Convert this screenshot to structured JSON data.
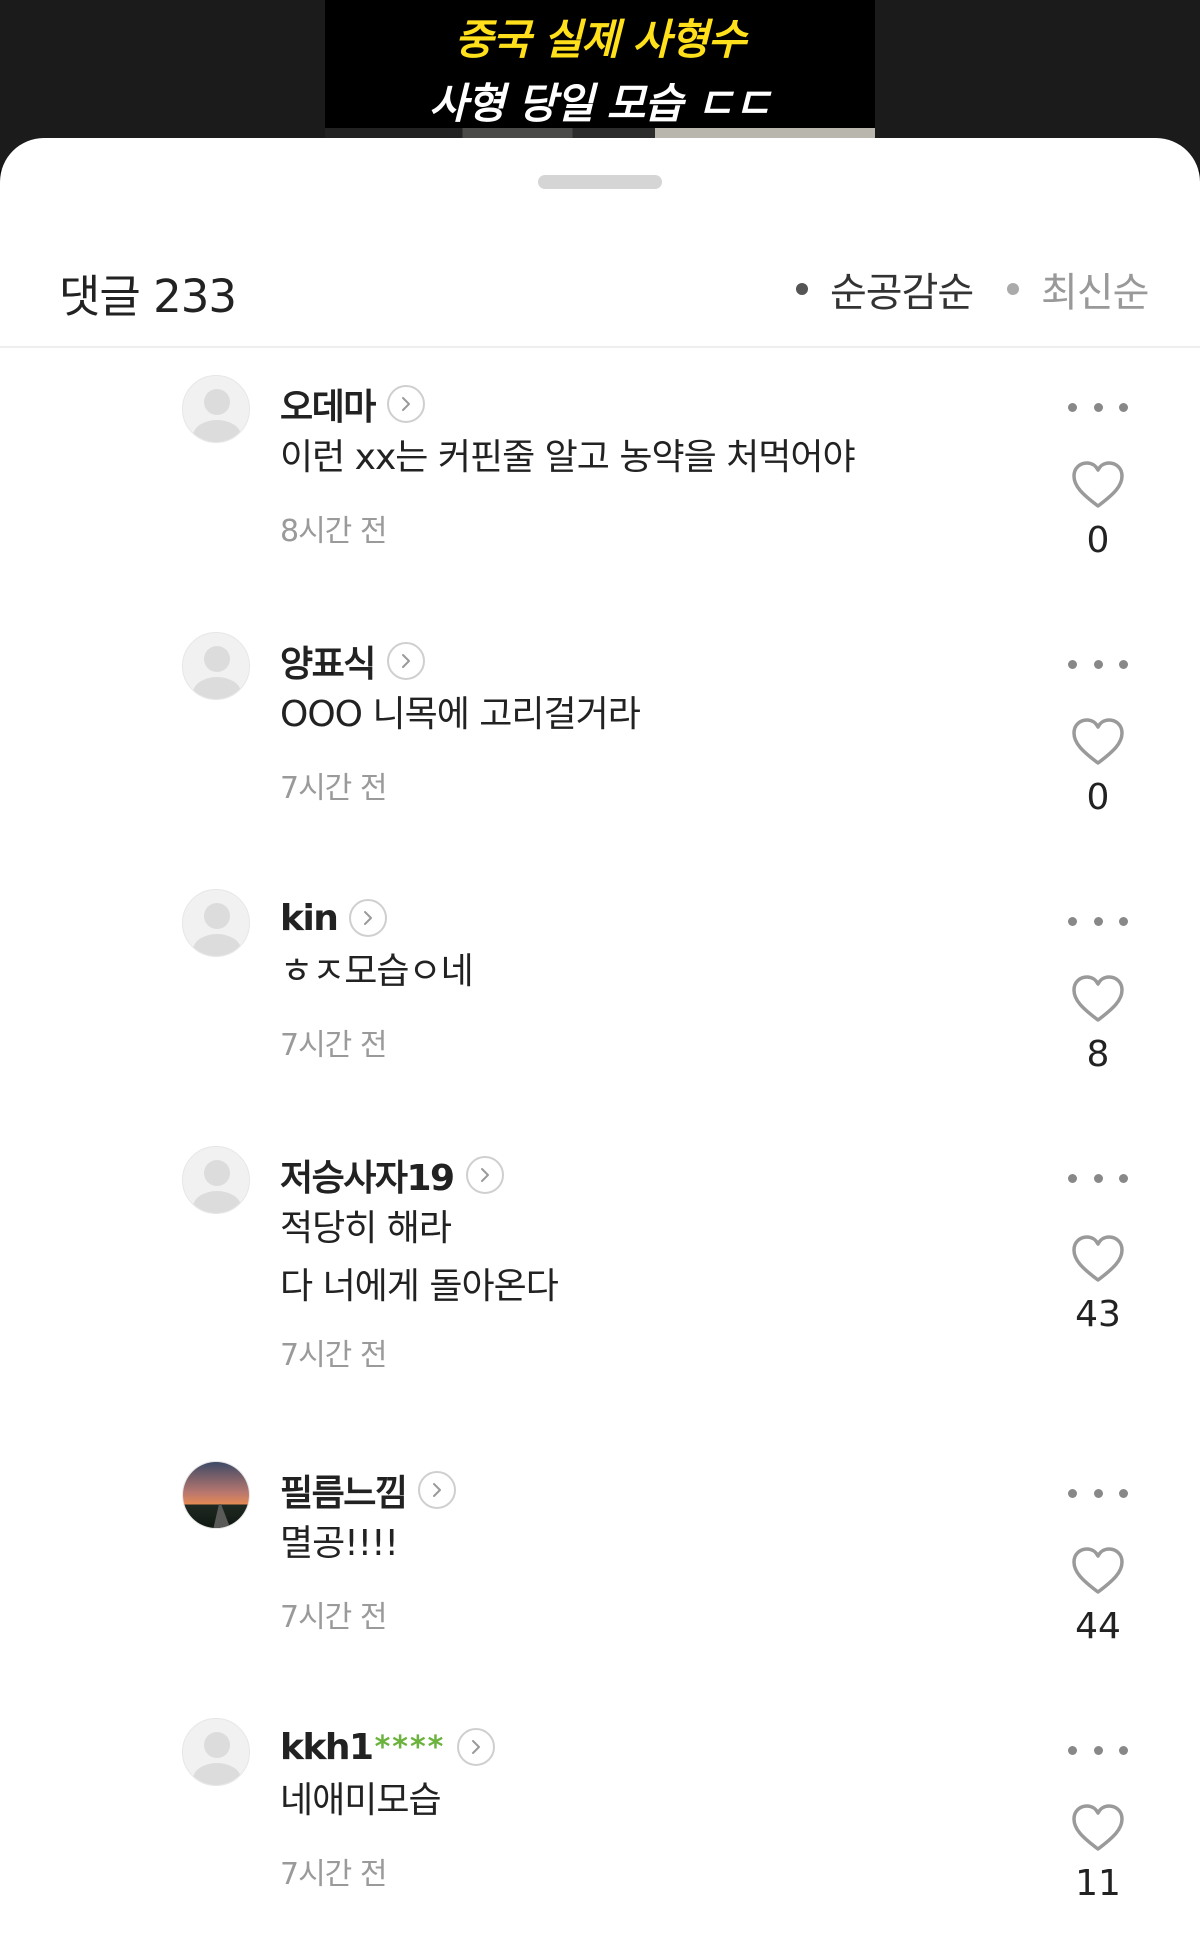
{
  "video": {
    "caption_line1": "중국 실제 사형수",
    "caption_line2": "사형 당일 모습 ㄷㄷ"
  },
  "header": {
    "count_label": "댓글 233",
    "sort_options": [
      "순공감순",
      "최신순"
    ],
    "active_sort": "순공감순"
  },
  "comments": [
    {
      "author": "오데마",
      "masked": "",
      "text": [
        "이런 xx는 커핀줄 알고 농약을 처먹어야"
      ],
      "time": "8시간 전",
      "likes": "0",
      "avatar": "default"
    },
    {
      "author": "양표식",
      "masked": "",
      "text": [
        "OOO 니목에 고리걸거라"
      ],
      "time": "7시간 전",
      "likes": "0",
      "avatar": "default"
    },
    {
      "author": "kin",
      "masked": "",
      "text": [
        "ㅎㅈ모습ㅇ네"
      ],
      "time": "7시간 전",
      "likes": "8",
      "avatar": "default"
    },
    {
      "author": "저승사자19",
      "masked": "",
      "text": [
        "적당히 해라",
        "다 너에게 돌아온다"
      ],
      "time": "7시간 전",
      "likes": "43",
      "avatar": "default"
    },
    {
      "author": "필름느낌",
      "masked": "",
      "text": [
        "멸공!!!!"
      ],
      "time": "7시간 전",
      "likes": "44",
      "avatar": "sunset-photo"
    },
    {
      "author": "kkh1",
      "masked": "****",
      "text": [
        "네애미모습"
      ],
      "time": "7시간 전",
      "likes": "11",
      "avatar": "default"
    }
  ],
  "colors": {
    "caption_yellow": "#ffe01a",
    "masked_green": "#6cb33e",
    "time_gray": "#9a9a9a"
  },
  "icons": {
    "more": "more-horizontal-icon",
    "like": "heart-outline-icon",
    "profile": "chevron-right-icon"
  }
}
